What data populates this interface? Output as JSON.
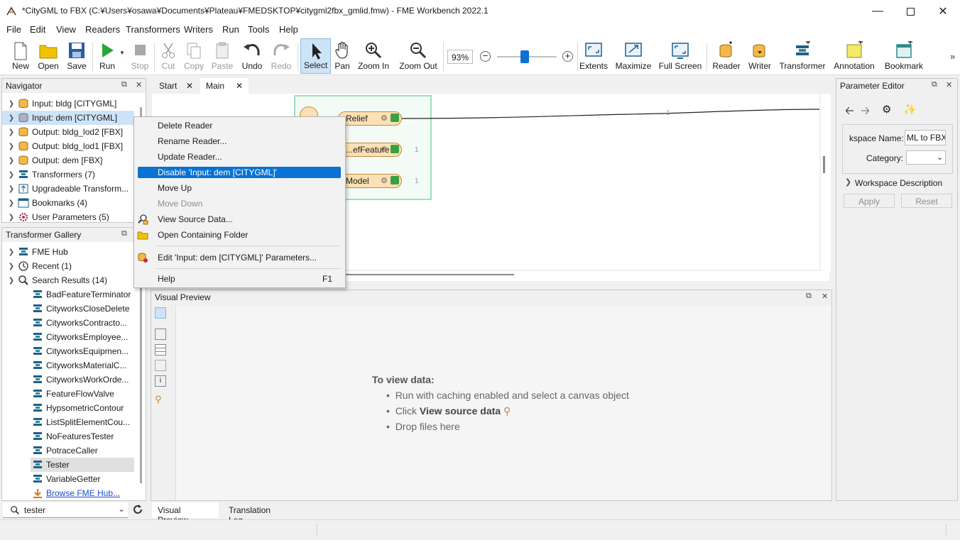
{
  "window": {
    "title": "*CityGML to FBX (C:¥Users¥osawa¥Documents¥Plateau¥FMEDSKTOP¥citygml2fbx_gmlid.fmw) - FME Workbench 2022.1"
  },
  "menu": [
    "File",
    "Edit",
    "View",
    "Readers",
    "Transformers",
    "Writers",
    "Run",
    "Tools",
    "Help"
  ],
  "toolbar": {
    "new": "New",
    "open": "Open",
    "save": "Save",
    "run": "Run",
    "stop": "Stop",
    "cut": "Cut",
    "copy": "Copy",
    "paste": "Paste",
    "undo": "Undo",
    "redo": "Redo",
    "select": "Select",
    "pan": "Pan",
    "zoom_in": "Zoom In",
    "zoom_out": "Zoom Out",
    "zoom_level": "93%",
    "zoom_slider_fraction": 0.47,
    "extents": "Extents",
    "maximize": "Maximize",
    "fullscreen": "Full Screen",
    "reader": "Reader",
    "writer": "Writer",
    "transformer": "Transformer",
    "annotation": "Annotation",
    "bookmark": "Bookmark",
    "more": "»"
  },
  "navigator": {
    "title": "Navigator",
    "items": [
      "Input: bldg [CITYGML]",
      "Input: dem [CITYGML]",
      "Output: bldg_lod2 [FBX]",
      "Output: bldg_lod1 [FBX]",
      "Output: dem [FBX]",
      "Transformers (7)",
      "Upgradeable Transform...",
      "Bookmarks (4)",
      "User Parameters (5)"
    ]
  },
  "gallery": {
    "title": "Transformer Gallery",
    "groups": [
      "FME Hub",
      "Recent (1)",
      "Search Results (14)"
    ],
    "results": [
      "BadFeatureTerminator",
      "CityworksCloseDelete",
      "CityworksContracto...",
      "CityworksEmployee...",
      "CityworksEquipmen...",
      "CityworksMaterialC...",
      "CityworksWorkOrde...",
      "FeatureFlowValve",
      "HypsometricContour",
      "ListSplitElementCou...",
      "NoFeaturesTester",
      "PotraceCaller",
      "Tester",
      "VariableGetter"
    ],
    "browse_link": "Browse FME Hub...",
    "search_value": "tester"
  },
  "canvas": {
    "tabs": [
      "Start",
      "Main"
    ],
    "features": [
      "Relief",
      "...efFeature",
      "Model"
    ],
    "port_count": "1",
    "link_count": "1"
  },
  "context_menu": {
    "items": [
      "Delete Reader",
      "Rename Reader...",
      "Update Reader...",
      "Disable 'Input: dem [CITYGML]'",
      "Move Up",
      "Move Down",
      "View Source Data...",
      "Open Containing Folder",
      "Edit 'Input: dem [CITYGML]' Parameters...",
      "Help"
    ],
    "help_key": "F1"
  },
  "preview": {
    "title": "Visual Preview",
    "heading": "To view data:",
    "bullets": [
      "Run with caching enabled and select a canvas object",
      "Click ",
      "Drop files here"
    ],
    "bullet2_bold": "View source data",
    "bottom_tabs": [
      "Visual Preview",
      "Translation Log"
    ]
  },
  "param_editor": {
    "title": "Parameter Editor",
    "workspace_name_label": "kspace Name:",
    "workspace_name_value": "ML to FBX",
    "category_label": "Category:",
    "workspace_desc": "Workspace Description",
    "apply": "Apply",
    "reset": "Reset"
  },
  "colors": {
    "accent": "#0a72d2",
    "node_fill": "#fde1b4",
    "bookmark_border": "#9de0b9",
    "icon_blue": "#1f5f8b",
    "icon_teal": "#2b8c8c"
  }
}
